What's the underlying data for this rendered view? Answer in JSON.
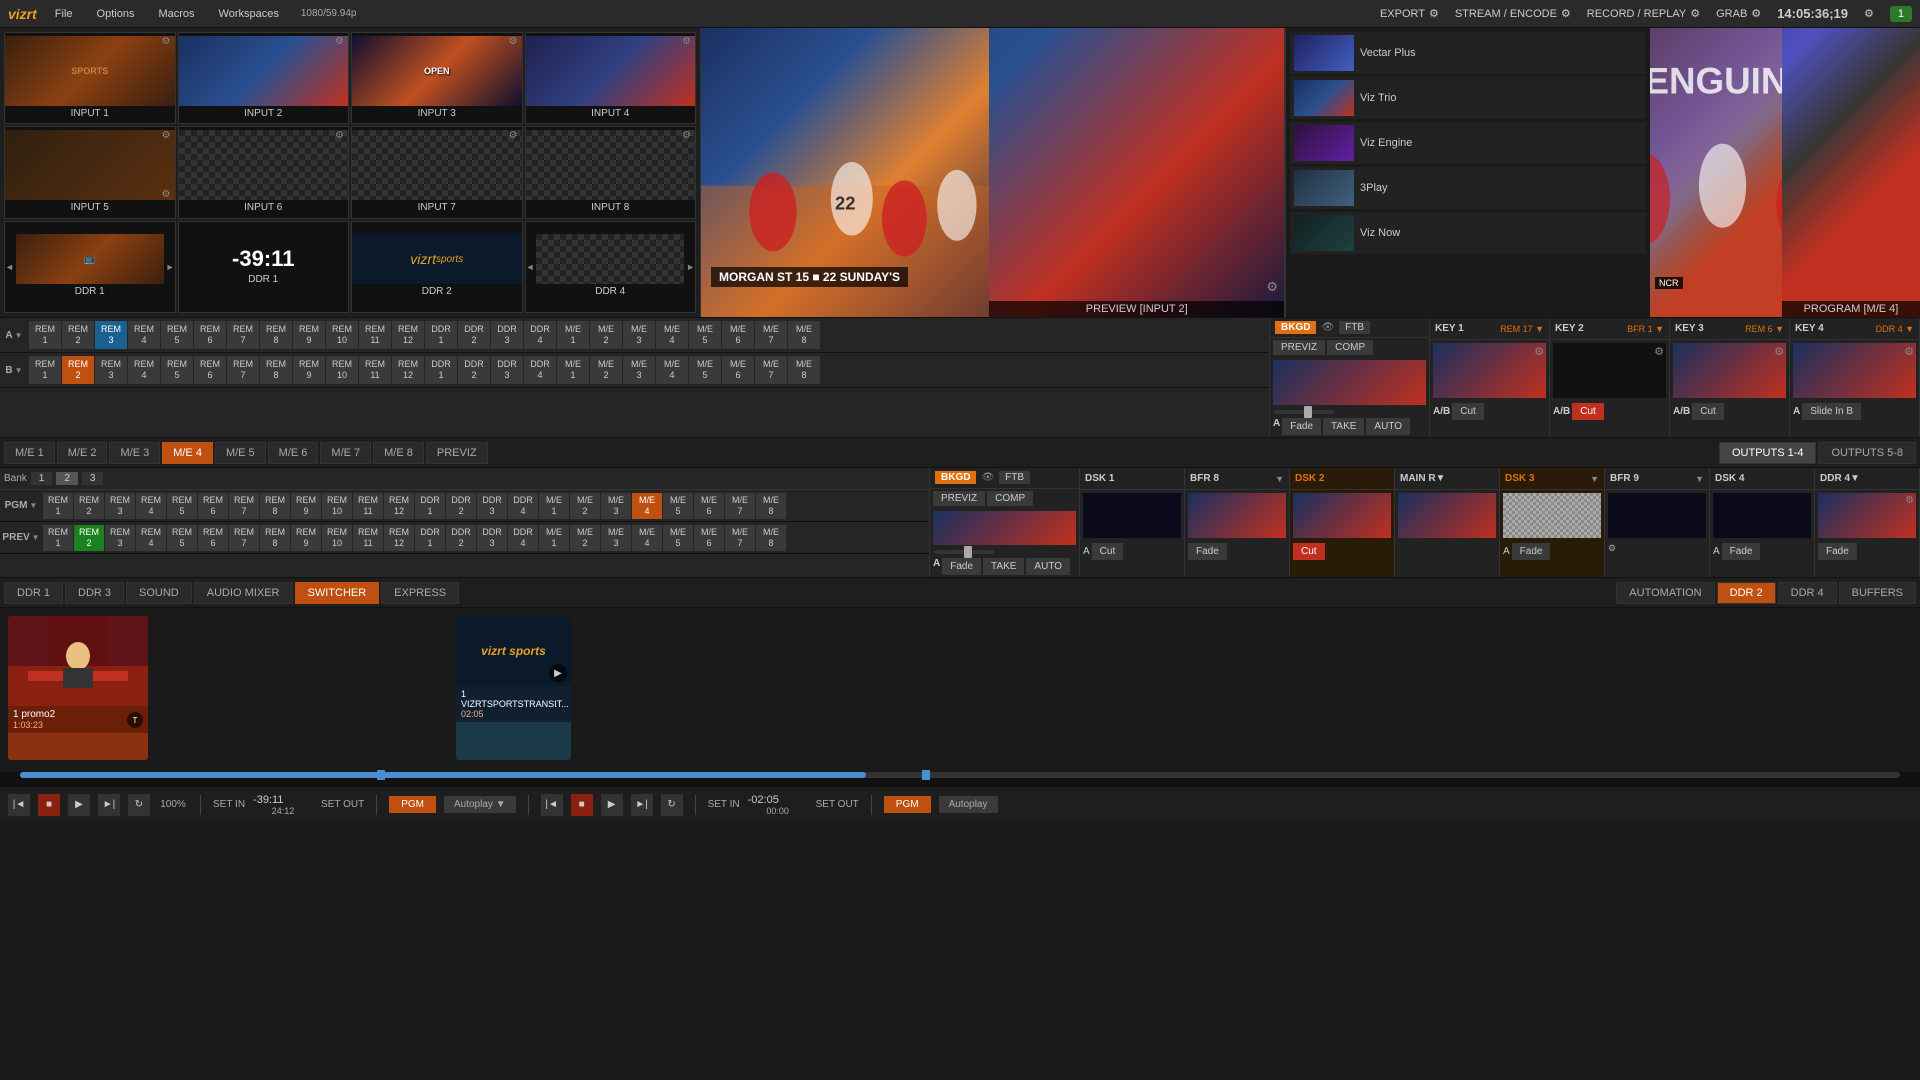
{
  "app": {
    "logo": "vizrt",
    "menu": [
      "File",
      "Options",
      "Macros",
      "Workspaces"
    ],
    "resolution": "1080/59.94p",
    "actions": [
      "EXPORT",
      "STREAM / ENCODE",
      "RECORD / REPLAY",
      "GRAB"
    ],
    "time": "14:05:36;19",
    "user_badge": "1"
  },
  "inputs": [
    {
      "id": "input1",
      "label": "INPUT 1",
      "type": "sports"
    },
    {
      "id": "input2",
      "label": "INPUT 2",
      "type": "sports2"
    },
    {
      "id": "input3",
      "label": "INPUT 3",
      "type": "text"
    },
    {
      "id": "input4",
      "label": "INPUT 4",
      "type": "sports3"
    },
    {
      "id": "input5",
      "label": "INPUT 5",
      "type": "wood"
    },
    {
      "id": "input6",
      "label": "INPUT 6",
      "type": "checker"
    },
    {
      "id": "input7",
      "label": "INPUT 7",
      "type": "checker"
    },
    {
      "id": "input8",
      "label": "INPUT 8",
      "type": "checker"
    },
    {
      "id": "ddr1_left",
      "label": "DDR 1",
      "type": "ddr_timecode",
      "timecode": ""
    },
    {
      "id": "ddr1",
      "label": "DDR 1",
      "type": "ddr_timecode",
      "timecode": "-39:11"
    },
    {
      "id": "ddr2",
      "label": "DDR 2",
      "type": "ddr_logo"
    },
    {
      "id": "ddr4",
      "label": "DDR 4",
      "type": "checker"
    }
  ],
  "preview": {
    "label": "PREVIEW [INPUT 2]",
    "source": "INPUT 2"
  },
  "program": {
    "label": "PROGRAM [M/E 4]",
    "source": "M/E 4"
  },
  "ext_sources": [
    {
      "name": "Vectar Plus",
      "type": "vectar"
    },
    {
      "name": "Viz Trio",
      "type": "trio"
    },
    {
      "name": "Viz Engine",
      "type": "engine"
    },
    {
      "name": "3Play",
      "type": "3play"
    },
    {
      "name": "Viz Now",
      "type": "viznow"
    }
  ],
  "switcher": {
    "rows": [
      {
        "label": "A",
        "buttons": [
          "REM 1",
          "REM 2",
          "REM 3",
          "REM 4",
          "REM 5",
          "REM 6",
          "REM 7",
          "REM 8",
          "REM 9",
          "REM 10",
          "REM 11",
          "REM 12",
          "DDR 1",
          "DDR 2",
          "DDR 3",
          "DDR 4",
          "M/E 1",
          "M/E 2",
          "M/E 3",
          "M/E 4",
          "M/E 5",
          "M/E 6",
          "M/E 7",
          "M/E 8"
        ],
        "active": 2
      },
      {
        "label": "B",
        "buttons": [
          "REM 1",
          "REM 2",
          "REM 3",
          "REM 4",
          "REM 5",
          "REM 6",
          "REM 7",
          "REM 8",
          "REM 9",
          "REM 10",
          "REM 11",
          "REM 12",
          "DDR 1",
          "DDR 2",
          "DDR 3",
          "DDR 4",
          "M/E 1",
          "M/E 2",
          "M/E 3",
          "M/E 4",
          "M/E 5",
          "M/E 6",
          "M/E 7",
          "M/E 8"
        ],
        "active": 1
      }
    ],
    "bkgd": {
      "label": "BKGD",
      "ftb_label": "FTB",
      "previz_label": "PREVIZ",
      "comp_label": "COMP",
      "take_label": "TAKE",
      "auto_label": "AUTO",
      "fade_label": "Fade",
      "a_label": "A"
    },
    "key1": {
      "label": "KEY 1",
      "source": "REM 17",
      "ab_label": "A/B",
      "cut_label": "Cut"
    },
    "key2": {
      "label": "KEY 2",
      "source": "BFR 1",
      "ab_label": "A/B",
      "cut_label": "Cut",
      "active": true
    },
    "key3": {
      "label": "KEY 3",
      "source": "REM 6",
      "ab_label": "A/B",
      "cut_label": "Cut"
    },
    "key4": {
      "label": "KEY 4",
      "source": "DDR 4",
      "slide_label": "Slide In B"
    }
  },
  "me_tabs": [
    "M/E 1",
    "M/E 2",
    "M/E 3",
    "M/E 4",
    "M/E 5",
    "M/E 6",
    "M/E 7",
    "M/E 8",
    "PREVIZ"
  ],
  "active_me_tab": "M/E 4",
  "outputs_tabs": [
    "OUTPUTS 1-4",
    "OUTPUTS 5-8"
  ],
  "switcher2": {
    "rows": [
      {
        "label": "PGM",
        "sub": "",
        "buttons": [
          "REM 1",
          "REM 2",
          "REM 3",
          "REM 4",
          "REM 5",
          "REM 6",
          "REM 7",
          "REM 8",
          "REM 9",
          "REM 10",
          "REM 11",
          "REM 12",
          "DDR 1",
          "DDR 2",
          "DDR 3",
          "DDR 4",
          "M/E 1",
          "M/E 2",
          "M/E 3",
          "M/E 4",
          "M/E 5",
          "M/E 6",
          "M/E 7",
          "M/E 8"
        ],
        "active": -1,
        "me_active": "M/E 4"
      },
      {
        "label": "PREV",
        "sub": "",
        "buttons": [
          "REM 1",
          "REM 2",
          "REM 3",
          "REM 4",
          "REM 5",
          "REM 6",
          "REM 7",
          "REM 8",
          "REM 9",
          "REM 10",
          "REM 11",
          "REM 12",
          "DDR 1",
          "DDR 2",
          "DDR 3",
          "DDR 4",
          "M/E 1",
          "M/E 2",
          "M/E 3",
          "M/E 4",
          "M/E 5",
          "M/E 6",
          "M/E 7",
          "M/E 8"
        ],
        "active": 1,
        "green_active": 1
      }
    ],
    "bank": {
      "label": "Bank",
      "options": [
        "1",
        "2",
        "3"
      ]
    },
    "bkgd": {
      "label": "BKGD",
      "ftb_label": "FTB"
    },
    "dsk1": {
      "label": "DSK 1",
      "cut_label": "Cut",
      "a_label": "A"
    },
    "bfr8": {
      "label": "BFR 8",
      "fade_label": "Fade"
    },
    "dsk2": {
      "label": "DSK 2",
      "cut_label": "Cut",
      "active": true
    },
    "mainr": {
      "label": "MAIN R▼"
    },
    "dsk3": {
      "label": "DSK 3",
      "fade_label": "Fade",
      "a_label": "A",
      "active": true
    },
    "bfr9": {
      "label": "BFR 9"
    },
    "dsk4": {
      "label": "DSK 4",
      "fade_label": "Fade",
      "a_label": "A"
    },
    "ddr4_panel": {
      "label": "DDR 4▼"
    }
  },
  "bottom_tabs": [
    "DDR 1",
    "DDR 3",
    "SOUND",
    "AUDIO MIXER"
  ],
  "active_bottom_tab": "SWITCHER",
  "switcher_tab": "SWITCHER",
  "express_tab": "EXPRESS",
  "right_tabs": [
    "AUTOMATION",
    "DDR 2",
    "DDR 4",
    "BUFFERS"
  ],
  "clips": [
    {
      "name": "1 promo2",
      "time": "1:03:23",
      "type": "sports_anchor",
      "has_i_icon": true
    },
    {
      "name": "1 VIZRTSPORTSTRANSIT...",
      "time": "02:05",
      "type": "logo"
    }
  ],
  "transport1": {
    "set_in_label": "SET IN",
    "timecode": "-39:11",
    "sub_timecode": "24:12",
    "set_out_label": "SET OUT",
    "zoom": "100%",
    "pgm_label": "PGM",
    "autoplay_label": "Autoplay",
    "autoplay_arrow": "▼"
  },
  "transport2": {
    "set_in_label": "SET IN",
    "timecode": "-02:05",
    "sub_timecode": "00:00",
    "set_out_label": "SET OUT",
    "pgm_label": "PGM",
    "autoplay_label": "Autoplay"
  }
}
